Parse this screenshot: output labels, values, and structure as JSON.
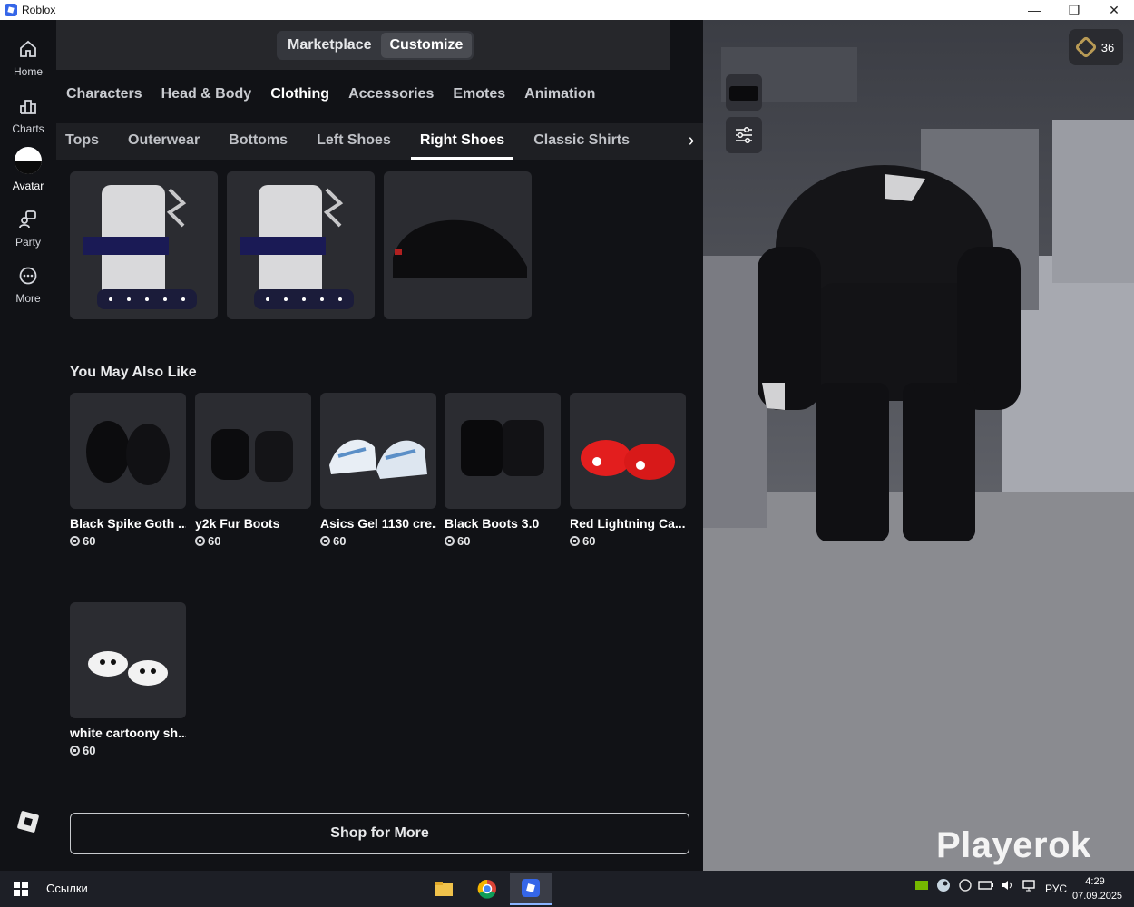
{
  "window": {
    "title": "Roblox",
    "minimize": "—",
    "restore": "❐",
    "close": "✕"
  },
  "nav": [
    {
      "label": "Home",
      "icon": "home-icon"
    },
    {
      "label": "Charts",
      "icon": "charts-icon"
    },
    {
      "label": "Avatar",
      "icon": "avatar-icon"
    },
    {
      "label": "Party",
      "icon": "party-icon"
    },
    {
      "label": "More",
      "icon": "more-icon"
    }
  ],
  "mode": {
    "marketplace": "Marketplace",
    "customize": "Customize",
    "active": "Customize"
  },
  "categories": [
    "Characters",
    "Head & Body",
    "Clothing",
    "Accessories",
    "Emotes",
    "Animation"
  ],
  "active_category": "Clothing",
  "subtabs": [
    "Tops",
    "Outerwear",
    "Bottoms",
    "Left Shoes",
    "Right Shoes",
    "Classic Shirts"
  ],
  "active_subtab": "Right Shoes",
  "owned_items": [
    {
      "icon": "white-spiked-boot-icon"
    },
    {
      "icon": "white-spiked-boot-icon"
    },
    {
      "icon": "black-sneaker-icon"
    }
  ],
  "recommend": {
    "title": "You May Also Like",
    "items": [
      {
        "name": "Black Spike Goth ...",
        "price": "60",
        "icon": "black-fur-boots-icon"
      },
      {
        "name": "y2k Fur Boots",
        "price": "60",
        "icon": "black-fur-boots-icon"
      },
      {
        "name": "Asics Gel 1130 cre...",
        "price": "60",
        "icon": "white-blue-sneakers-icon"
      },
      {
        "name": "Black Boots 3.0",
        "price": "60",
        "icon": "black-boots-icon"
      },
      {
        "name": "Red Lightning Ca...",
        "price": "60",
        "icon": "red-clogs-icon"
      },
      {
        "name": "white cartoony sh...",
        "price": "60",
        "icon": "white-cartoon-shoes-icon"
      }
    ]
  },
  "shop_button": "Shop for More",
  "robux": {
    "amount": "36"
  },
  "watermark": "Playerok",
  "taskbar": {
    "links": "Ссылки",
    "lang": "РУС",
    "time": "4:29",
    "date": "07.09.2025"
  },
  "colors": {
    "bg": "#111216",
    "card": "#2b2c31",
    "accent_white": "#ffffff",
    "robux_gold": "#b89a55"
  }
}
